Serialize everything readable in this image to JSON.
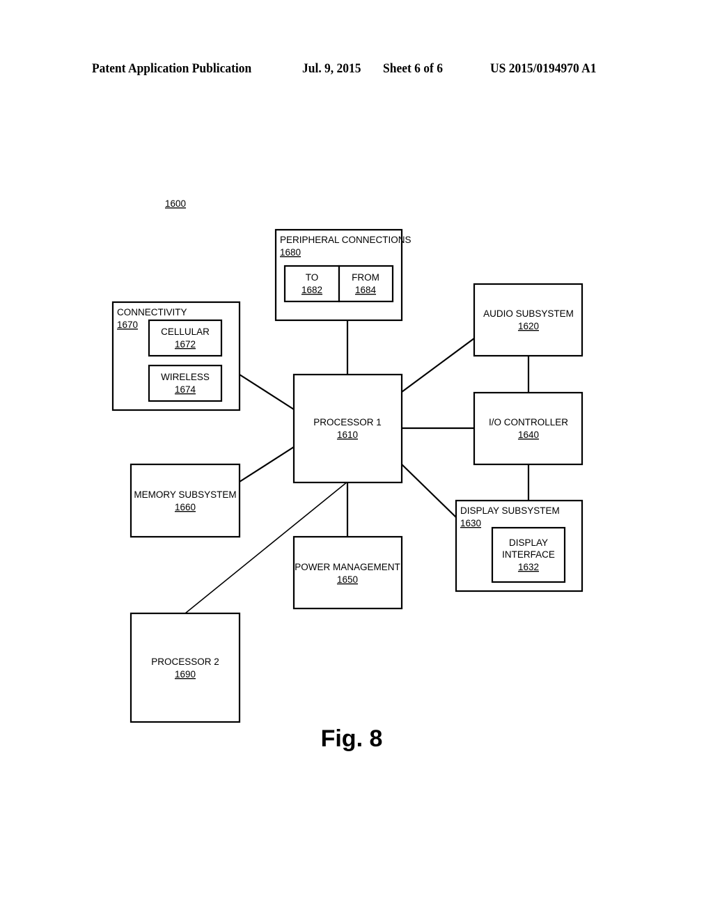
{
  "header": {
    "publication": "Patent Application Publication",
    "date": "Jul. 9, 2015",
    "sheet": "Sheet 6 of 6",
    "patent_number": "US 2015/0194970 A1"
  },
  "figure": {
    "system_ref": "1600",
    "caption": "Fig. 8"
  },
  "blocks": {
    "peripheral": {
      "label": "PERIPHERAL CONNECTIONS",
      "ref": "1680"
    },
    "to": {
      "label": "TO",
      "ref": "1682"
    },
    "from": {
      "label": "FROM",
      "ref": "1684"
    },
    "connectivity": {
      "label": "CONNECTIVITY",
      "ref": "1670"
    },
    "cellular": {
      "label": "CELLULAR",
      "ref": "1672"
    },
    "wireless": {
      "label": "WIRELESS",
      "ref": "1674"
    },
    "processor1": {
      "label": "PROCESSOR 1",
      "ref": "1610"
    },
    "audio": {
      "label": "AUDIO SUBSYSTEM",
      "ref": "1620"
    },
    "io": {
      "label": "I/O CONTROLLER",
      "ref": "1640"
    },
    "display": {
      "label": "DISPLAY SUBSYSTEM",
      "ref": "1630"
    },
    "display_interface": {
      "label_line1": "DISPLAY",
      "label_line2": "INTERFACE",
      "ref": "1632"
    },
    "memory": {
      "label": "MEMORY SUBSYSTEM",
      "ref": "1660"
    },
    "power": {
      "label": "POWER MANAGEMENT",
      "ref": "1650"
    },
    "processor2": {
      "label": "PROCESSOR 2",
      "ref": "1690"
    }
  },
  "connections": [
    [
      "processor1",
      "peripheral"
    ],
    [
      "processor1",
      "connectivity"
    ],
    [
      "processor1",
      "memory"
    ],
    [
      "processor1",
      "audio"
    ],
    [
      "processor1",
      "io"
    ],
    [
      "processor1",
      "display"
    ],
    [
      "processor1",
      "power"
    ],
    [
      "processor1",
      "processor2"
    ],
    [
      "audio",
      "io"
    ],
    [
      "io",
      "display"
    ]
  ]
}
